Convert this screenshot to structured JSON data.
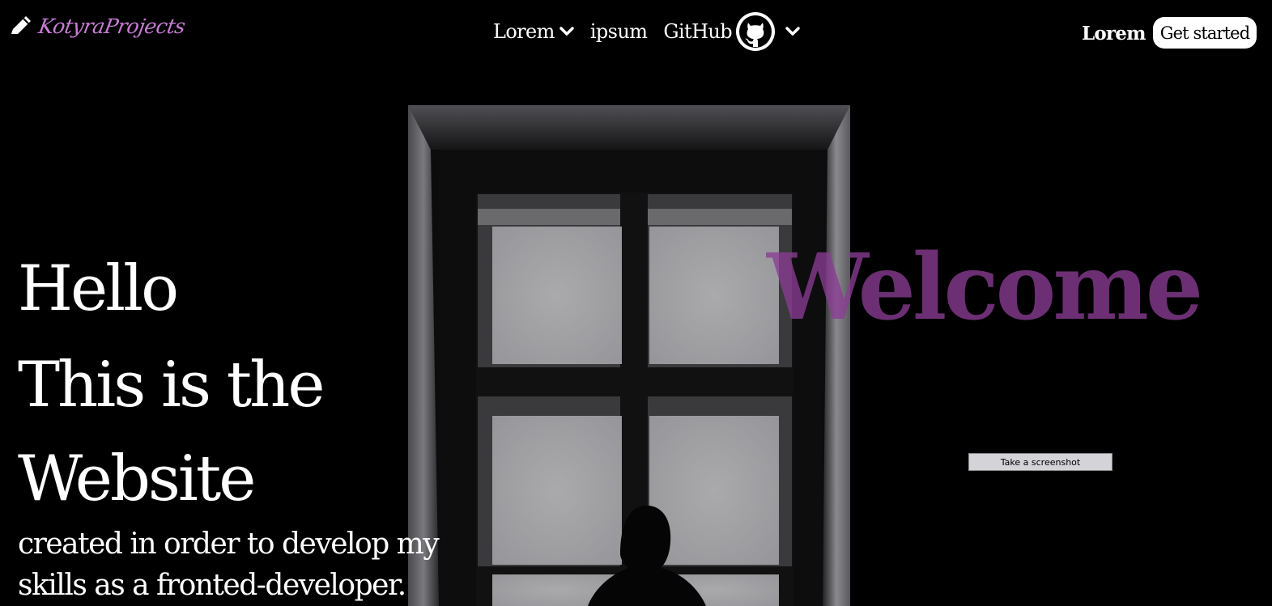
{
  "header": {
    "logo_text": "KotyraProjects",
    "logo_color": "#c77dd4",
    "nav": {
      "item1_label": "Lorem",
      "item2_label": "ipsum",
      "item3_label": "GitHub"
    },
    "lorem_link": "Lorem",
    "get_started": "Get started"
  },
  "hero": {
    "welcome": "Welcome",
    "welcome_color": "#8a3c94",
    "headline": [
      "Hello",
      "This is the",
      "Website"
    ],
    "subtitle": [
      "created in order to develop my",
      "skills as a fronted-developer."
    ],
    "screenshot_button": "Take a screenshot"
  }
}
